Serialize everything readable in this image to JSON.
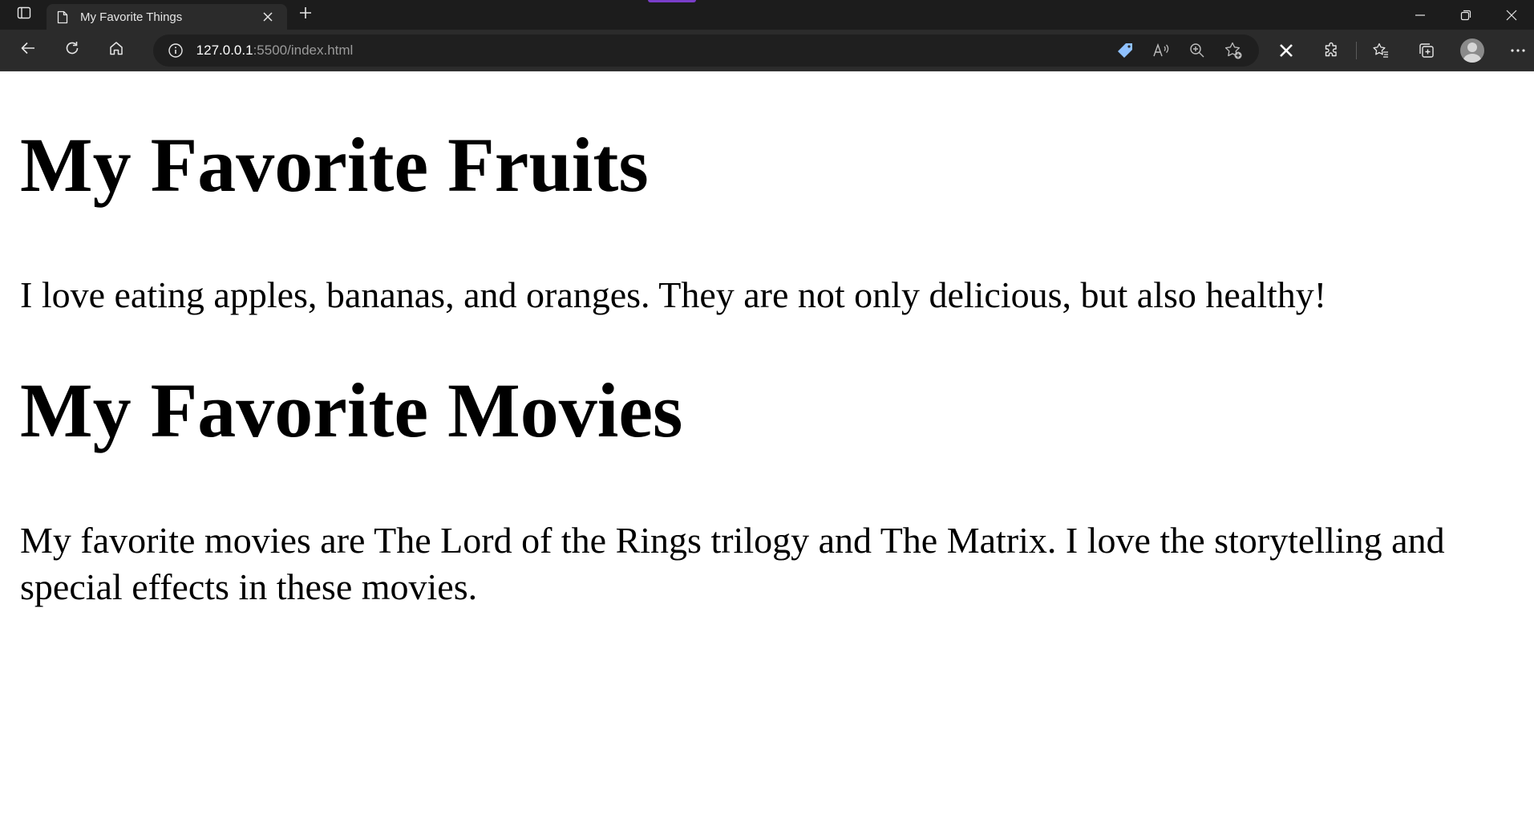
{
  "browser": {
    "tab": {
      "title": "My Favorite Things"
    },
    "address_bar": {
      "url_host": "127.0.0.1",
      "url_rest": ":5500/index.html"
    },
    "icons": {
      "tab_actions": "tab-actions-icon",
      "page_favicon": "document-icon",
      "tab_close": "close-icon",
      "new_tab": "plus-icon",
      "back": "back-arrow-icon",
      "refresh": "refresh-icon",
      "home": "home-icon",
      "site_info": "info-icon",
      "coupon": "tag-icon",
      "read_aloud": "read-aloud-icon",
      "zoom": "zoom-icon",
      "add_favorite": "star-plus-icon",
      "extension_x": "x-extension-icon",
      "extensions": "puzzle-icon",
      "favorites": "favorites-list-icon",
      "collections": "collections-icon",
      "profile": "profile-avatar",
      "menu": "more-icon"
    },
    "accent_color": "#7a3ec9",
    "tag_icon_color": "#8fc1ff"
  },
  "page": {
    "sections": [
      {
        "heading": "My Favorite Fruits",
        "paragraph": "I love eating apples, bananas, and oranges. They are not only delicious, but also healthy!"
      },
      {
        "heading": "My Favorite Movies",
        "paragraph": "My favorite movies are The Lord of the Rings trilogy and The Matrix. I love the storytelling and special effects in these movies."
      }
    ]
  }
}
